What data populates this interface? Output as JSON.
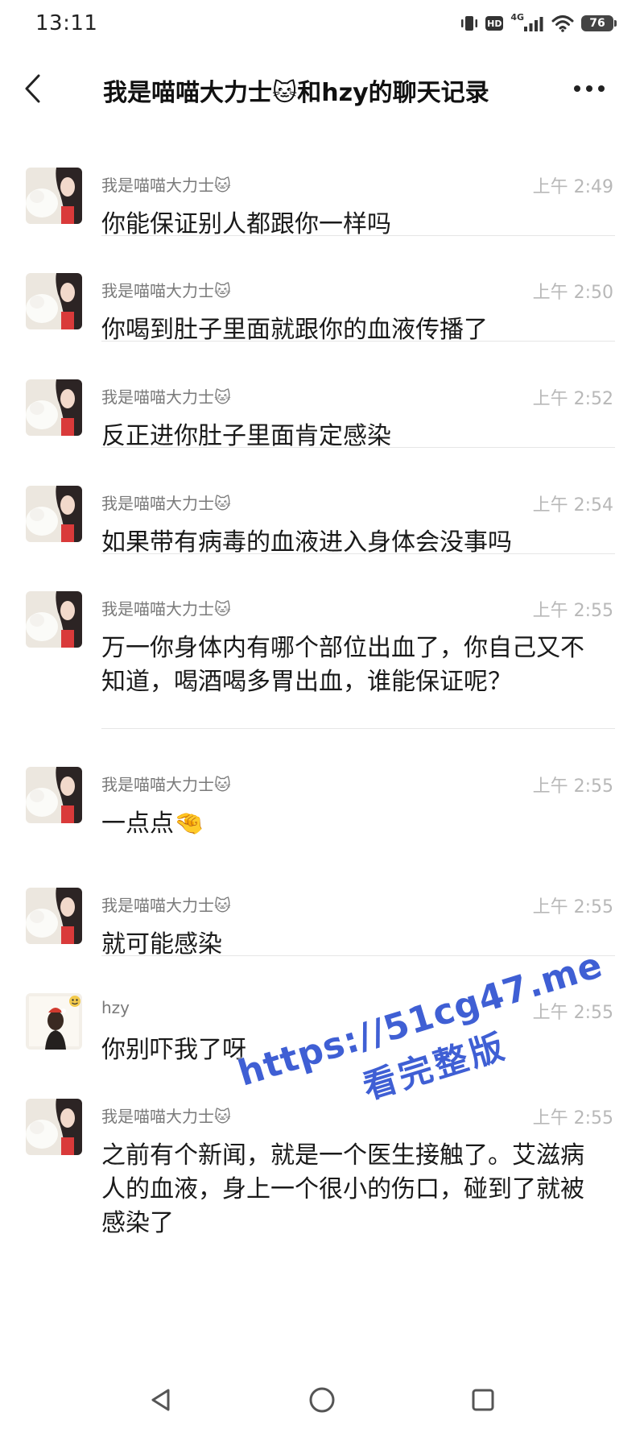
{
  "status_bar": {
    "time": "13:11",
    "hd": "HD",
    "network": "4G",
    "battery": "76"
  },
  "header": {
    "title": "我是喵喵大力士🐱和hzy的聊天记录"
  },
  "messages": [
    {
      "sender": "我是喵喵大力士🐱",
      "time": "上午 2:49",
      "text": "你能保证别人都跟你一样吗",
      "avatar": "girl-avatar"
    },
    {
      "sender": "我是喵喵大力士🐱",
      "time": "上午 2:50",
      "text": "你喝到肚子里面就跟你的血液传播了",
      "avatar": "girl-avatar"
    },
    {
      "sender": "我是喵喵大力士🐱",
      "time": "上午 2:52",
      "text": "反正进你肚子里面肯定感染",
      "avatar": "girl-avatar"
    },
    {
      "sender": "我是喵喵大力士🐱",
      "time": "上午 2:54",
      "text": "如果带有病毒的血液进入身体会没事吗",
      "avatar": "girl-avatar"
    },
    {
      "sender": "我是喵喵大力士🐱",
      "time": "上午 2:55",
      "text": "万一你身体内有哪个部位出血了，你自己又不知道，喝酒喝多胃出血，谁能保证呢？",
      "avatar": "girl-avatar"
    },
    {
      "sender": "我是喵喵大力士🐱",
      "time": "上午 2:55",
      "text": "一点点🤏",
      "avatar": "girl-avatar"
    },
    {
      "sender": "我是喵喵大力士🐱",
      "time": "上午 2:55",
      "text": "就可能感染",
      "avatar": "girl-avatar"
    },
    {
      "sender": "hzy",
      "time": "上午 2:55",
      "text": "你别吓我了呀",
      "avatar": "hzy-avatar"
    },
    {
      "sender": "我是喵喵大力士🐱",
      "time": "上午 2:55",
      "text": "之前有个新闻，就是一个医生接触了。艾滋病人的血液，身上一个很小的伤口，碰到了就被感染了",
      "avatar": "girl-avatar"
    }
  ],
  "watermark": {
    "url": "https://51cg47.me",
    "text": "看完整版"
  }
}
